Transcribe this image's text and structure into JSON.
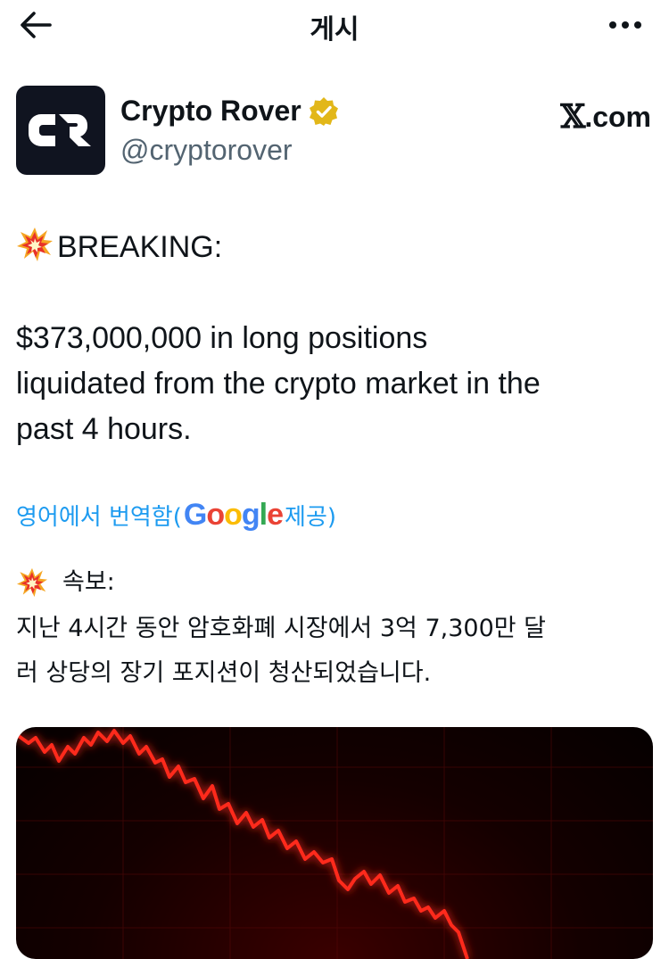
{
  "topbar": {
    "title": "게시",
    "back_icon": "arrow-left-icon",
    "more_icon": "more-horizontal-icon"
  },
  "author": {
    "name": "Crypto Rover",
    "handle": "@cryptorover",
    "verified_badge_color": "#e2b719",
    "avatar_initials": "CR",
    "source": ".com",
    "source_logo": "𝕏"
  },
  "tweet": {
    "line1": "BREAKING:",
    "body_lines": [
      "$373,000,000 in long positions",
      "liquidated from the crypto market in the",
      "past 4 hours."
    ]
  },
  "translation": {
    "link_prefix": "영어에서 번역함(",
    "provider": "Google",
    "link_suffix": " 제공)",
    "head": "속보:",
    "lines": [
      "지난 4시간 동안 암호화폐 시장에서 3억 7,300만 달",
      "러 상당의 장기 포지션이 청산되었습니다."
    ]
  },
  "colors": {
    "link": "#1d9bf0",
    "handle": "#536471",
    "text": "#0f1419",
    "chart_line": "#ff2a1a"
  }
}
